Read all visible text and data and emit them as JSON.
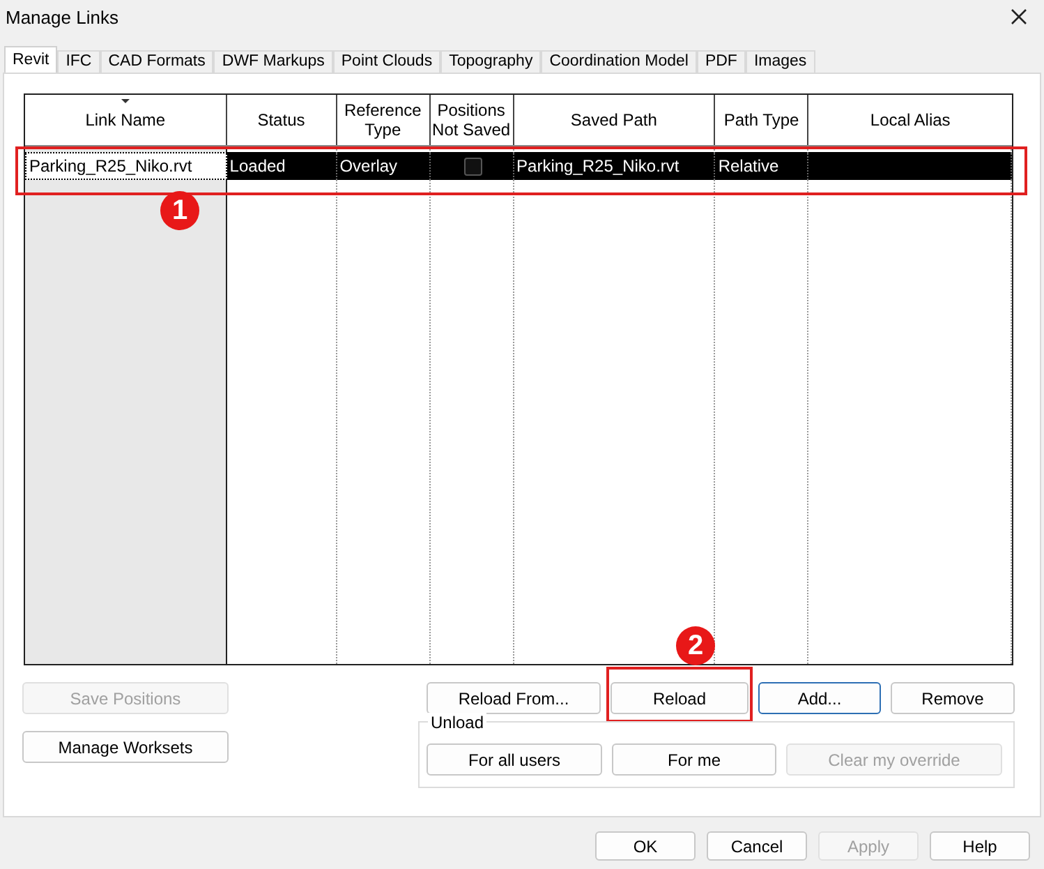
{
  "window": {
    "title": "Manage Links"
  },
  "tabs": [
    {
      "label": "Revit",
      "selected": true
    },
    {
      "label": "IFC",
      "selected": false
    },
    {
      "label": "CAD Formats",
      "selected": false
    },
    {
      "label": "DWF Markups",
      "selected": false
    },
    {
      "label": "Point Clouds",
      "selected": false
    },
    {
      "label": "Topography",
      "selected": false
    },
    {
      "label": "Coordination Model",
      "selected": false
    },
    {
      "label": "PDF",
      "selected": false
    },
    {
      "label": "Images",
      "selected": false
    }
  ],
  "table": {
    "columns": [
      {
        "label": "Link Name",
        "sorted": true
      },
      {
        "label": "Status",
        "sorted": false
      },
      {
        "label": "Reference Type",
        "sorted": false
      },
      {
        "label": "Positions Not Saved",
        "sorted": false
      },
      {
        "label": "Saved Path",
        "sorted": false
      },
      {
        "label": "Path Type",
        "sorted": false
      },
      {
        "label": "Local Alias",
        "sorted": false
      }
    ],
    "rows": [
      {
        "selected": true,
        "link_name": "Parking_R25_Niko.rvt",
        "status": "Loaded",
        "reference_type": "Overlay",
        "positions_not_saved": false,
        "saved_path": "Parking_R25_Niko.rvt",
        "path_type": "Relative",
        "marker": "1"
      }
    ]
  },
  "left_buttons": [
    {
      "label": "Save Positions",
      "disabled": true
    },
    {
      "label": "Manage Worksets",
      "disabled": false
    }
  ],
  "link_buttons": [
    {
      "label": "Reload From...",
      "disabled": false,
      "focused": false
    },
    {
      "label": "Reload",
      "disabled": false,
      "focused": false,
      "marker": "2"
    },
    {
      "label": "Add...",
      "disabled": false,
      "focused": true
    },
    {
      "label": "Remove",
      "disabled": false,
      "focused": false
    }
  ],
  "unload": {
    "title": "Unload",
    "buttons": [
      {
        "label": "For all users",
        "disabled": false
      },
      {
        "label": "For me",
        "disabled": false
      },
      {
        "label": "Clear my override",
        "disabled": true
      }
    ]
  },
  "dialog_buttons": [
    {
      "label": "OK",
      "disabled": false
    },
    {
      "label": "Cancel",
      "disabled": false
    },
    {
      "label": "Apply",
      "disabled": true
    },
    {
      "label": "Help",
      "disabled": false
    }
  ]
}
